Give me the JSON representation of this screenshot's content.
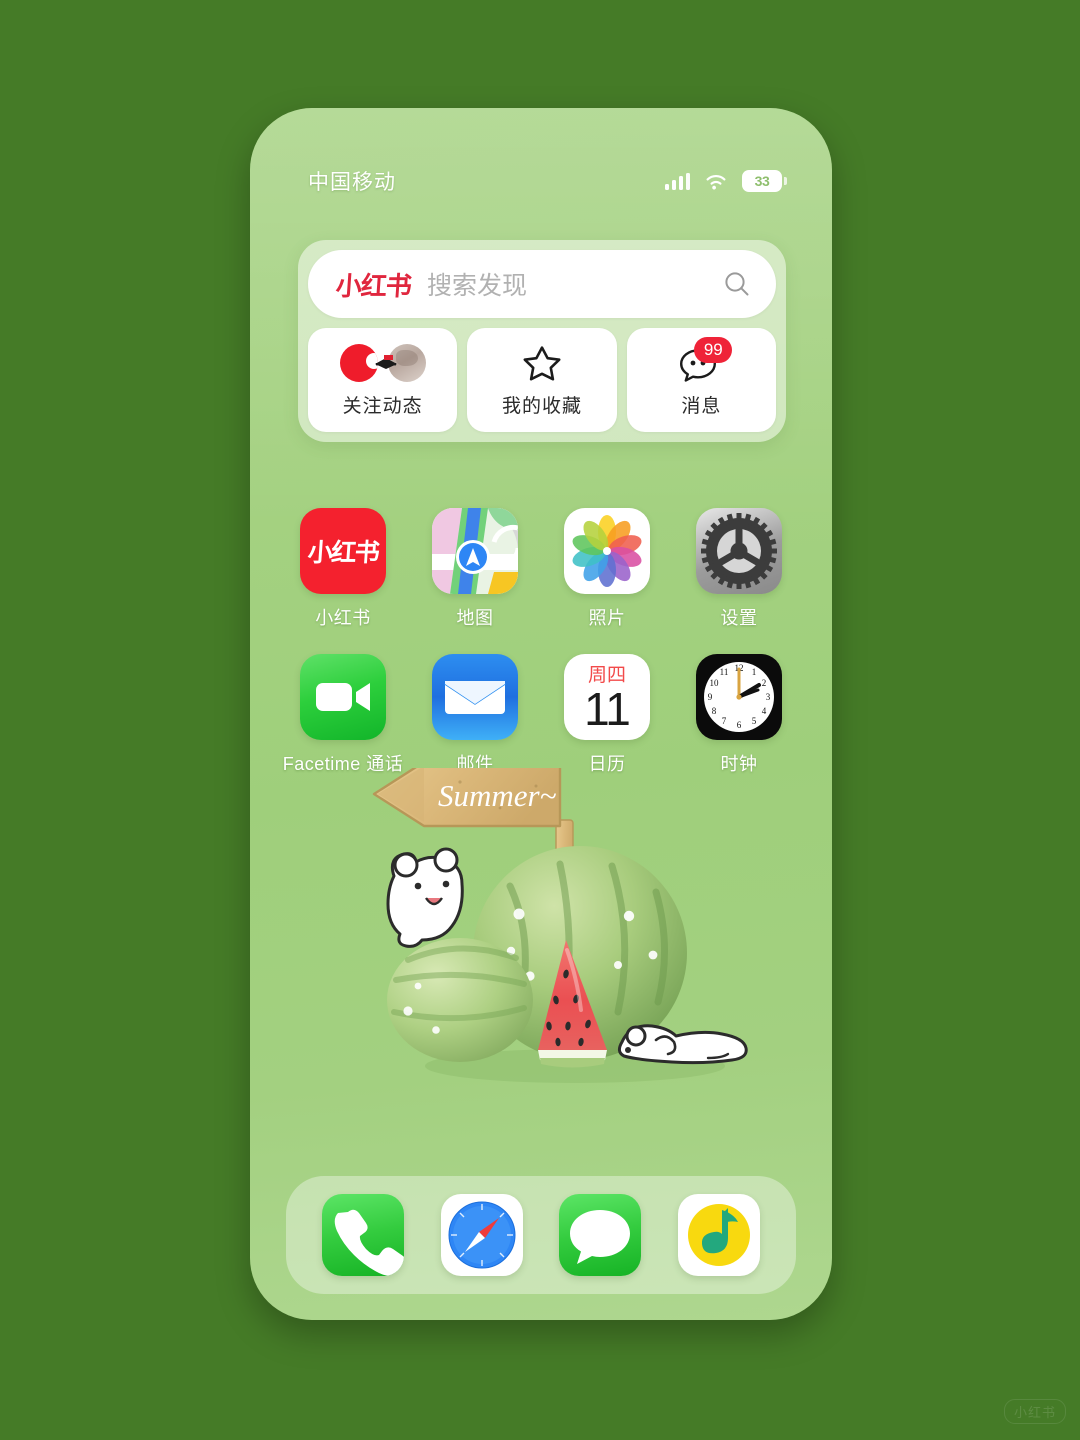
{
  "theme": {
    "page_background": "#457b27",
    "phone_background": "#a4d280",
    "brand_red": "#e0263e",
    "badge_red": "#ef2338",
    "label_white": "#ffffff"
  },
  "status_bar": {
    "carrier": "中国移动",
    "signal_icon": "signal-bars-icon",
    "wifi_icon": "wifi-icon",
    "battery_percent": "33",
    "battery_icon": "battery-icon"
  },
  "widget": {
    "search": {
      "brand": "小红书",
      "placeholder": "搜索发现",
      "search_icon": "search-icon"
    },
    "shortcuts": [
      {
        "label": "关注动态",
        "icon": "avatar-group-icon",
        "badge": ""
      },
      {
        "label": "我的收藏",
        "icon": "star-icon",
        "badge": ""
      },
      {
        "label": "消息",
        "icon": "chat-bubble-icon",
        "badge": "99"
      }
    ]
  },
  "home_screen": {
    "rows": [
      [
        {
          "label": "小红书",
          "icon": "xiaohongshu-icon",
          "glyph": "小红书"
        },
        {
          "label": "地图",
          "icon": "maps-icon"
        },
        {
          "label": "照片",
          "icon": "photos-icon"
        },
        {
          "label": "设置",
          "icon": "settings-icon"
        }
      ],
      [
        {
          "label": "Facetime 通话",
          "icon": "facetime-icon"
        },
        {
          "label": "邮件",
          "icon": "mail-icon"
        },
        {
          "label": "日历",
          "icon": "calendar-icon",
          "day_of_week": "周四",
          "day": "11"
        },
        {
          "label": "时钟",
          "icon": "clock-icon"
        }
      ]
    ]
  },
  "wallpaper": {
    "signpost_text": "Summer~",
    "art_description": "watercolor-watermelons-with-white-bears"
  },
  "dock": {
    "items": [
      {
        "label": "电话",
        "icon": "phone-icon"
      },
      {
        "label": "Safari 浏览器",
        "icon": "safari-compass-icon"
      },
      {
        "label": "信息",
        "icon": "messages-icon"
      },
      {
        "label": "QQ音乐",
        "icon": "qq-music-note-icon"
      }
    ]
  },
  "watermark": {
    "text": "小红书"
  }
}
